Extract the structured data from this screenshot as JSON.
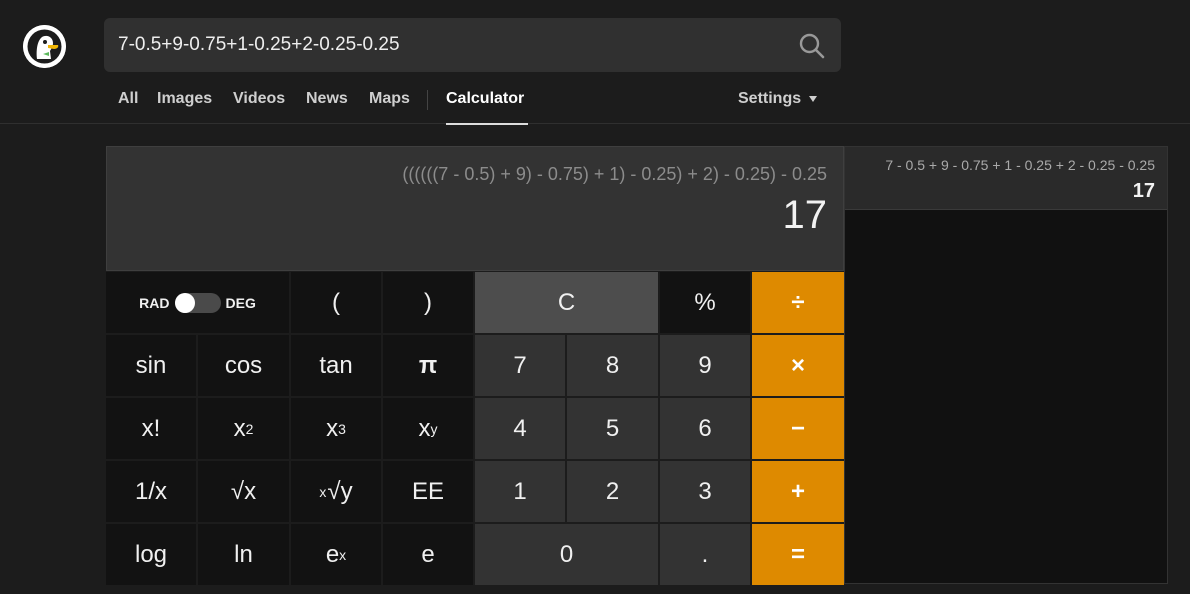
{
  "search": {
    "query": "7-0.5+9-0.75+1-0.25+2-0.25-0.25"
  },
  "nav": {
    "items": [
      "All",
      "Images",
      "Videos",
      "News",
      "Maps",
      "Calculator"
    ],
    "active": "Calculator",
    "settings_label": "Settings"
  },
  "calculator": {
    "expression": "((((((7 - 0.5) + 9) - 0.75) + 1) - 0.25) + 2) - 0.25) - 0.25",
    "result": "17",
    "mode_left": "RAD",
    "mode_right": "DEG",
    "keys": {
      "open_paren": "(",
      "close_paren": ")",
      "clear": "C",
      "percent": "%",
      "divide": "÷",
      "sin": "sin",
      "cos": "cos",
      "tan": "tan",
      "pi": "π",
      "seven": "7",
      "eight": "8",
      "nine": "9",
      "multiply": "×",
      "factorial": "x!",
      "x_base": "x",
      "sq_exp": "2",
      "cube_exp": "3",
      "pow_exp": "y",
      "four": "4",
      "five": "5",
      "six": "6",
      "minus": "−",
      "reciprocal": "1/x",
      "sqrt": "√x",
      "root_pre": "x",
      "root_main": "√y",
      "ee": "EE",
      "one": "1",
      "two": "2",
      "three": "3",
      "plus": "+",
      "log": "log",
      "ln": "ln",
      "e_base": "e",
      "e_exp": "x",
      "e": "e",
      "zero": "0",
      "decimal": ".",
      "equals": "="
    },
    "colors": {
      "operator": "#de8a00",
      "display": "#333333",
      "number_key": "#333333",
      "function_key": "#121212"
    }
  },
  "history": [
    {
      "expression": "7 - 0.5 + 9 - 0.75 + 1 - 0.25 + 2 - 0.25 - 0.25",
      "result": "17"
    }
  ],
  "icons": {
    "search": "magnifier-icon",
    "logo": "duck-logo-icon",
    "settings": "caret-down-icon"
  }
}
